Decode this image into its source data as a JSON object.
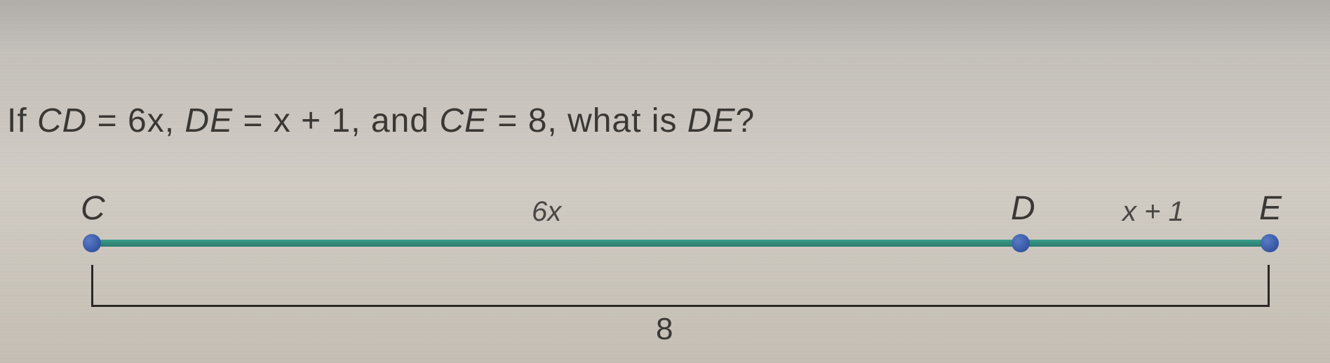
{
  "question": {
    "prefix": "If ",
    "var1": "CD",
    "eq1": " = 6x, ",
    "var2": "DE",
    "eq2": " = x + 1, and ",
    "var3": "CE",
    "eq3": " = 8, what is ",
    "var4": "DE",
    "suffix": "?"
  },
  "diagram": {
    "points": {
      "c": "C",
      "d": "D",
      "e": "E"
    },
    "segments": {
      "cd": "6x",
      "de": "x + 1"
    },
    "total": "8"
  },
  "chart_data": {
    "type": "number-line-segment",
    "points": [
      "C",
      "D",
      "E"
    ],
    "segments": [
      {
        "from": "C",
        "to": "D",
        "label": "6x"
      },
      {
        "from": "D",
        "to": "E",
        "label": "x + 1"
      }
    ],
    "total_segment": {
      "from": "C",
      "to": "E",
      "label": "8"
    },
    "given": {
      "CD": "6x",
      "DE": "x + 1",
      "CE": 8
    },
    "asked": "DE"
  }
}
